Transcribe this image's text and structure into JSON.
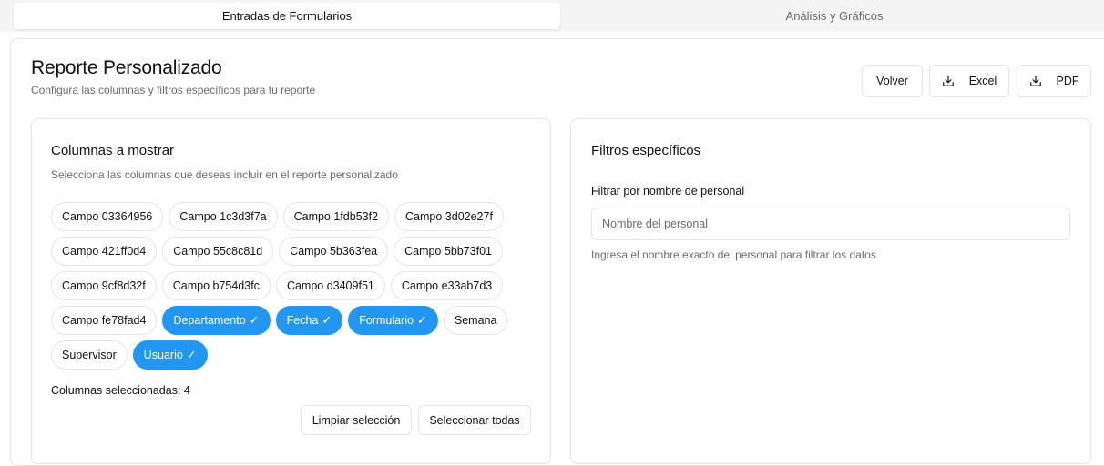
{
  "tabs": [
    {
      "label": "Entradas de Formularios",
      "active": true
    },
    {
      "label": "Análisis y Gráficos",
      "active": false
    }
  ],
  "header": {
    "title": "Reporte Personalizado",
    "subtitle": "Configura las columnas y filtros específicos para tu reporte",
    "volver_label": "Volver",
    "excel_label": "Excel",
    "pdf_label": "PDF"
  },
  "columns_panel": {
    "title": "Columnas a mostrar",
    "description": "Selecciona las columnas que deseas incluir en el reporte personalizado",
    "chips": [
      {
        "label": "Campo 03364956",
        "selected": false
      },
      {
        "label": "Campo 1c3d3f7a",
        "selected": false
      },
      {
        "label": "Campo 1fdb53f2",
        "selected": false
      },
      {
        "label": "Campo 3d02e27f",
        "selected": false
      },
      {
        "label": "Campo 421ff0d4",
        "selected": false
      },
      {
        "label": "Campo 55c8c81d",
        "selected": false
      },
      {
        "label": "Campo 5b363fea",
        "selected": false
      },
      {
        "label": "Campo 5bb73f01",
        "selected": false
      },
      {
        "label": "Campo 9cf8d32f",
        "selected": false
      },
      {
        "label": "Campo b754d3fc",
        "selected": false
      },
      {
        "label": "Campo d3409f51",
        "selected": false
      },
      {
        "label": "Campo e33ab7d3",
        "selected": false
      },
      {
        "label": "Campo fe78fad4",
        "selected": false
      },
      {
        "label": "Departamento",
        "selected": true
      },
      {
        "label": "Fecha",
        "selected": true
      },
      {
        "label": "Formulario",
        "selected": true
      },
      {
        "label": "Semana",
        "selected": false
      },
      {
        "label": "Supervisor",
        "selected": false
      },
      {
        "label": "Usuario",
        "selected": true
      }
    ],
    "check_glyph": "✓",
    "selected_count_text": "Columnas seleccionadas: 4",
    "clear_label": "Limpiar selección",
    "select_all_label": "Seleccionar todas"
  },
  "filters_panel": {
    "title": "Filtros específicos",
    "name_filter_label": "Filtrar por nombre de personal",
    "name_filter_placeholder": "Nombre del personal",
    "name_filter_value": "",
    "name_filter_help": "Ingresa el nombre exacto del personal para filtrar los datos"
  },
  "colors": {
    "accent": "#2196f3",
    "muted_text": "#6b6b6b",
    "border": "#e4e4e7"
  },
  "icons": {
    "excel": "download-icon",
    "pdf": "download-icon"
  }
}
